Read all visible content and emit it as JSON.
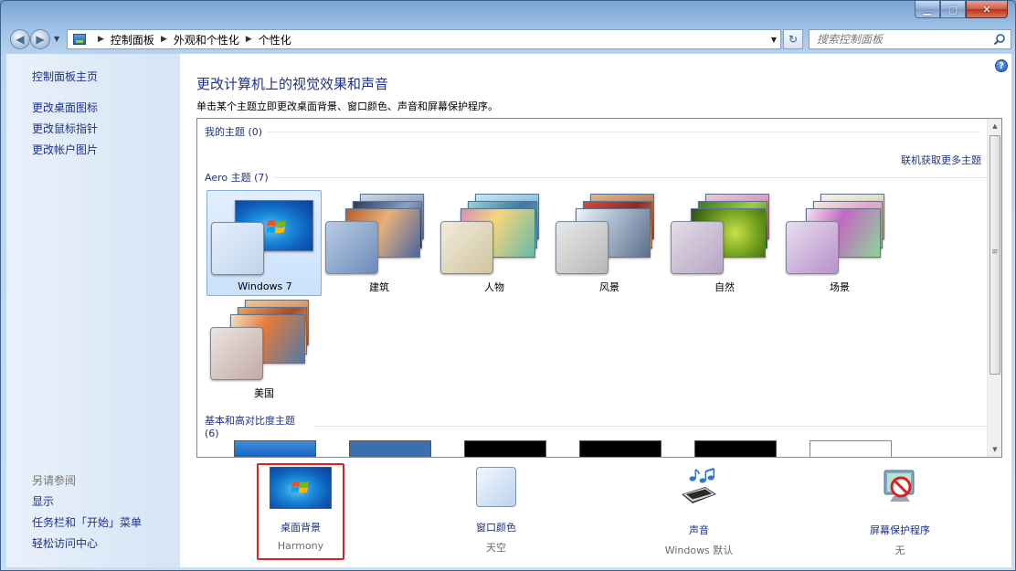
{
  "window": {
    "min_icon": "minimize-icon",
    "max_icon": "maximize-icon",
    "close_icon": "close-icon"
  },
  "breadcrumb": [
    "控制面板",
    "外观和个性化",
    "个性化"
  ],
  "search": {
    "placeholder": "搜索控制面板"
  },
  "left_pane": {
    "home": "控制面板主页",
    "links": [
      "更改桌面图标",
      "更改鼠标指针",
      "更改帐户图片"
    ],
    "see_also_title": "另请参阅",
    "see_also": [
      "显示",
      "任务栏和「开始」菜单",
      "轻松访问中心"
    ]
  },
  "main": {
    "title": "更改计算机上的视觉效果和声音",
    "subtitle": "单击某个主题立即更改桌面背景、窗口颜色、声音和屏幕保护程序。",
    "help": "?",
    "my_themes": "我的主题 (0)",
    "get_more": "联机获取更多主题",
    "aero_themes": "Aero 主题 (7)",
    "basic_themes": "基本和高对比度主题 (6)",
    "themes": [
      "Windows 7",
      "建筑",
      "人物",
      "风景",
      "自然",
      "场景",
      "美国"
    ],
    "selected_theme": "Windows 7"
  },
  "bottom": {
    "items": [
      {
        "label": "桌面背景",
        "value": "Harmony"
      },
      {
        "label": "窗口颜色",
        "value": "天空"
      },
      {
        "label": "声音",
        "value": "Windows 默认"
      },
      {
        "label": "屏幕保护程序",
        "value": "无"
      }
    ]
  }
}
